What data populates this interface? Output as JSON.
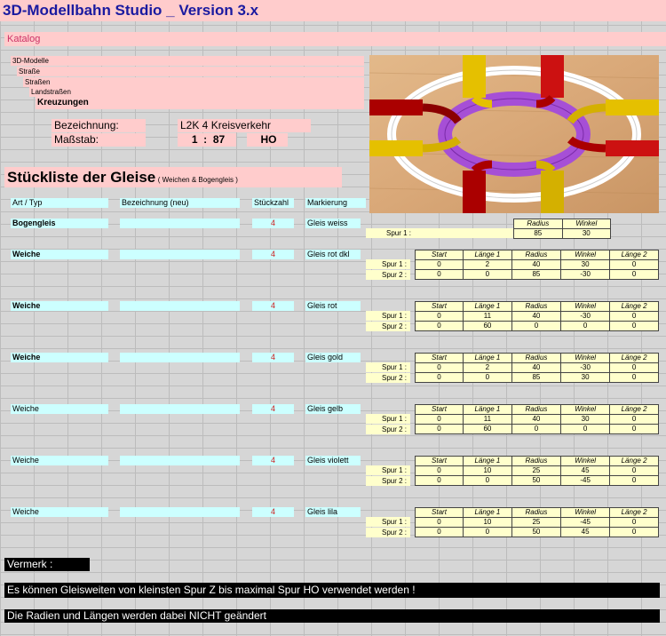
{
  "app": {
    "title": "3D-Modellbahn Studio _ Version 3.x"
  },
  "catalog": {
    "label": "Katalog",
    "breadcrumb": [
      "3D-Modelle",
      "Straße",
      "Straßen",
      "Landstraßen",
      "Kreuzungen"
    ]
  },
  "info": {
    "bezeichnung_label": "Bezeichnung:",
    "bezeichnung_value": "L2K 4 Kreisverkehr",
    "massstab_label": "Maßstab:",
    "massstab_ratio": "1  :  87",
    "massstab_scale": "HO"
  },
  "stueckliste": {
    "title": "Stückliste der Gleise",
    "subtitle": "( Weichen & Bogengleis )",
    "headers": {
      "art": "Art / Typ",
      "bez": "Bezeichnung (neu)",
      "qty": "Stückzahl",
      "mark": "Markierung"
    }
  },
  "tracks": [
    {
      "art": "Bogengleis",
      "bold": true,
      "qty": "4",
      "mark": "Gleis weiss",
      "cols": [
        "Radius",
        "Winkel"
      ],
      "rows": [
        {
          "label": "Spur 1 :",
          "values": [
            "85",
            "30"
          ]
        }
      ]
    },
    {
      "art": "Weiche",
      "bold": true,
      "qty": "4",
      "mark": "Gleis rot dkl",
      "cols": [
        "Start",
        "Länge 1",
        "Radius",
        "Winkel",
        "Länge 2"
      ],
      "rows": [
        {
          "label": "Spur 1 :",
          "values": [
            "0",
            "2",
            "40",
            "30",
            "0"
          ]
        },
        {
          "label": "Spur 2 :",
          "values": [
            "0",
            "0",
            "85",
            "-30",
            "0"
          ]
        }
      ]
    },
    {
      "art": "Weiche",
      "bold": true,
      "qty": "4",
      "mark": "Gleis rot",
      "cols": [
        "Start",
        "Länge 1",
        "Radius",
        "Winkel",
        "Länge 2"
      ],
      "rows": [
        {
          "label": "Spur 1 :",
          "values": [
            "0",
            "11",
            "40",
            "-30",
            "0"
          ]
        },
        {
          "label": "Spur 2 :",
          "values": [
            "0",
            "60",
            "0",
            "0",
            "0"
          ]
        }
      ]
    },
    {
      "art": "Weiche",
      "bold": true,
      "qty": "4",
      "mark": "Gleis gold",
      "cols": [
        "Start",
        "Länge 1",
        "Radius",
        "Winkel",
        "Länge 2"
      ],
      "rows": [
        {
          "label": "Spur 1 :",
          "values": [
            "0",
            "2",
            "40",
            "-30",
            "0"
          ]
        },
        {
          "label": "Spur 2 :",
          "values": [
            "0",
            "0",
            "85",
            "30",
            "0"
          ]
        }
      ]
    },
    {
      "art": "Weiche",
      "bold": false,
      "qty": "4",
      "mark": "Gleis gelb",
      "cols": [
        "Start",
        "Länge 1",
        "Radius",
        "Winkel",
        "Länge 2"
      ],
      "rows": [
        {
          "label": "Spur 1 :",
          "values": [
            "0",
            "11",
            "40",
            "30",
            "0"
          ]
        },
        {
          "label": "Spur 2 :",
          "values": [
            "0",
            "60",
            "0",
            "0",
            "0"
          ]
        }
      ]
    },
    {
      "art": "Weiche",
      "bold": false,
      "qty": "4",
      "mark": "Gleis violett",
      "cols": [
        "Start",
        "Länge 1",
        "Radius",
        "Winkel",
        "Länge 2"
      ],
      "rows": [
        {
          "label": "Spur 1 :",
          "values": [
            "0",
            "10",
            "25",
            "45",
            "0"
          ]
        },
        {
          "label": "Spur 2 :",
          "values": [
            "0",
            "0",
            "50",
            "-45",
            "0"
          ]
        }
      ]
    },
    {
      "art": "Weiche",
      "bold": false,
      "qty": "4",
      "mark": "Gleis lila",
      "cols": [
        "Start",
        "Länge 1",
        "Radius",
        "Winkel",
        "Länge 2"
      ],
      "rows": [
        {
          "label": "Spur 1 :",
          "values": [
            "0",
            "10",
            "25",
            "-45",
            "0"
          ]
        },
        {
          "label": "Spur 2 :",
          "values": [
            "0",
            "0",
            "50",
            "45",
            "0"
          ]
        }
      ]
    }
  ],
  "notes": {
    "vermerk": "Vermerk :",
    "line1": "Es können Gleisweiten von kleinsten Spur Z bis maximal Spur HO verwendet werden !",
    "line2": "Die Radien und Längen werden dabei NICHT geändert"
  },
  "colors": {
    "pink": "#ffcccc",
    "cyan": "#ccffff",
    "yellow": "#ffffcc",
    "title": "#1a1aa0",
    "katalog": "#cc3366"
  }
}
